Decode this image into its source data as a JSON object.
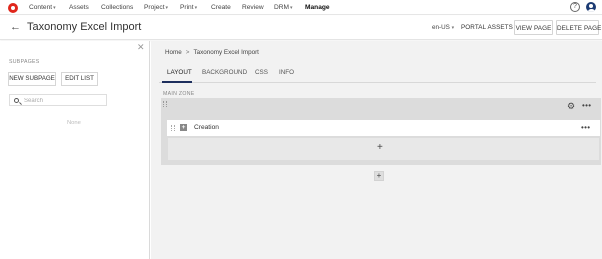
{
  "topnav": {
    "items": [
      {
        "label": "Content",
        "caret": "▾"
      },
      {
        "label": "Assets",
        "caret": ""
      },
      {
        "label": "Collections",
        "caret": ""
      },
      {
        "label": "Project",
        "caret": "▾"
      },
      {
        "label": "Print",
        "caret": "▾"
      },
      {
        "label": "Create",
        "caret": ""
      },
      {
        "label": "Review",
        "caret": ""
      },
      {
        "label": "DRM",
        "caret": "▾"
      },
      {
        "label": "Manage",
        "caret": ""
      }
    ],
    "help_glyph": "?",
    "icons": {
      "logo": "brand-logo-icon",
      "help": "help-icon",
      "user": "user-avatar-icon"
    }
  },
  "header": {
    "back_glyph": "←",
    "title": "Taxonomy Excel Import",
    "language": "en-US",
    "language_caret": "▾",
    "portal_assets": "PORTAL ASSETS",
    "view_page": "VIEW PAGE",
    "delete_page": "DELETE PAGE"
  },
  "sidebar": {
    "close_glyph": "✕",
    "section_label": "SUBPAGES",
    "new_subpage": "NEW SUBPAGE",
    "edit_list": "EDIT LIST",
    "search_placeholder": "Search",
    "empty_text": "None"
  },
  "main": {
    "breadcrumb": [
      "Home",
      "Taxonomy Excel Import"
    ],
    "breadcrumb_sep": ">",
    "tabs": [
      "LAYOUT",
      "BACKGROUND",
      "CSS",
      "INFO"
    ],
    "active_tab": "LAYOUT",
    "zone_label": "MAIN ZONE",
    "gear_glyph": "⚙",
    "more_glyph": "•••",
    "component_plus": "+",
    "component_label": "Creation",
    "add_glyph": "+"
  },
  "colors": {
    "brand_red": "#e0261b",
    "tab_underline": "#1e2f5e",
    "avatar": "#1c3b73",
    "main_bg": "#f2f2f2",
    "zone_bg": "#dcdcdc"
  }
}
